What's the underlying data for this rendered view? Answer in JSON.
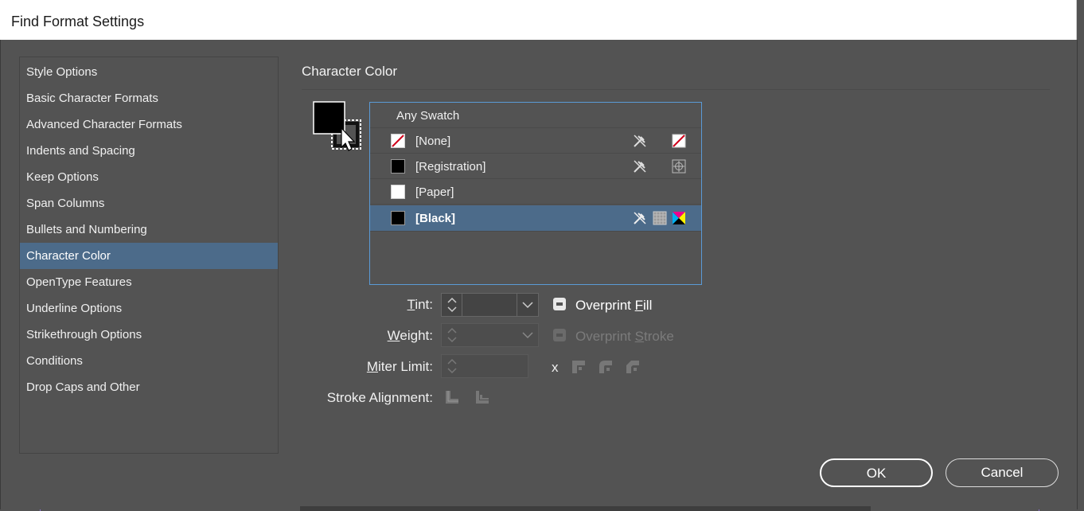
{
  "window": {
    "title": "Find Format Settings"
  },
  "sidebar": {
    "items": [
      {
        "label": "Style Options"
      },
      {
        "label": "Basic Character Formats"
      },
      {
        "label": "Advanced Character Formats"
      },
      {
        "label": "Indents and Spacing"
      },
      {
        "label": "Keep Options"
      },
      {
        "label": "Span Columns"
      },
      {
        "label": "Bullets and Numbering"
      },
      {
        "label": "Character Color",
        "selected": true
      },
      {
        "label": "OpenType Features"
      },
      {
        "label": "Underline Options"
      },
      {
        "label": "Strikethrough Options"
      },
      {
        "label": "Conditions"
      },
      {
        "label": "Drop Caps and Other"
      }
    ]
  },
  "panel": {
    "title": "Character Color",
    "swatches": {
      "any": "Any Swatch",
      "items": [
        {
          "name": "[None]",
          "chip": "none"
        },
        {
          "name": "[Registration]",
          "chip": "#000000"
        },
        {
          "name": "[Paper]",
          "chip": "#ffffff"
        },
        {
          "name": "[Black]",
          "chip": "#000000",
          "selected": true
        }
      ]
    },
    "tint": {
      "label_pre": "",
      "label_u": "T",
      "label_post": "int:",
      "value": ""
    },
    "weight": {
      "label_u": "W",
      "label_post": "eight:",
      "value": ""
    },
    "miter": {
      "label_u": "M",
      "label_post": "iter Limit:",
      "value": "",
      "x": "x"
    },
    "stroke_alignment": {
      "label": "Stroke Alignment:"
    },
    "overprint_fill": {
      "pre": "Overprint ",
      "u": "F",
      "post": "ill"
    },
    "overprint_stroke": {
      "pre": "Overprint ",
      "u": "S",
      "post": "troke"
    }
  },
  "buttons": {
    "ok": "OK",
    "cancel": "Cancel"
  },
  "colors": {
    "selection": "#4c6b8a",
    "panel": "#535353",
    "list_border": "#5a9ad6"
  }
}
